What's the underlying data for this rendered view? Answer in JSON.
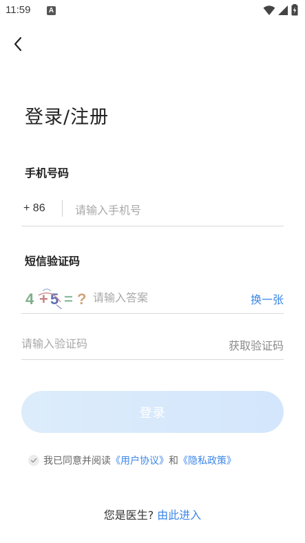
{
  "status_bar": {
    "time": "11:59",
    "notification_icon_letter": "A",
    "icons": [
      "wifi-icon",
      "signal-icon",
      "battery-charging-icon"
    ]
  },
  "header": {
    "back_icon": "chevron-left-icon"
  },
  "page": {
    "title": "登录/注册"
  },
  "phone": {
    "label": "手机号码",
    "country_code": "+ 86",
    "placeholder": "请输入手机号"
  },
  "sms": {
    "label": "短信验证码",
    "captcha_text": "4+5=?",
    "captcha_placeholder": "请输入答案",
    "refresh_label": "换一张",
    "code_placeholder": "请输入验证码",
    "get_code_label": "获取验证码"
  },
  "login": {
    "button_label": "登录",
    "button_color": "#d8e9fb"
  },
  "agreement": {
    "prefix": "我已同意并阅读",
    "user_agreement": "《用户协议》",
    "joiner": "和",
    "privacy_policy": "《隐私政策》",
    "link_color": "#3b86e8"
  },
  "doctor": {
    "question": "您是医生?",
    "link": "由此进入"
  }
}
